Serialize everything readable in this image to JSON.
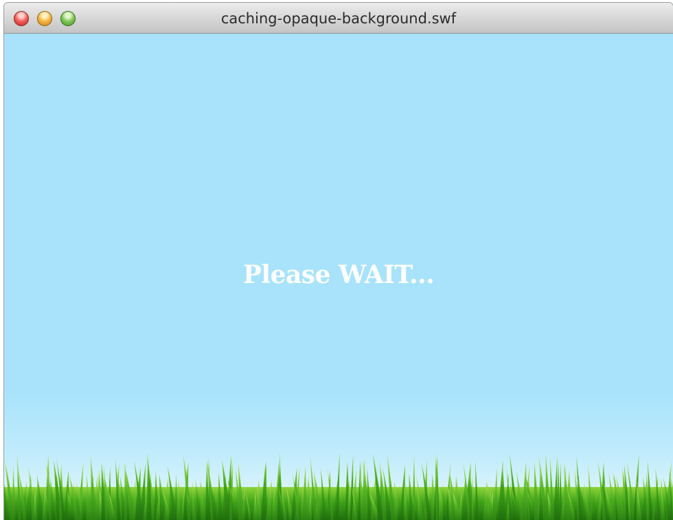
{
  "window": {
    "title": "caching-opaque-background.swf",
    "controls": {
      "close_color": "#f2605a",
      "minimize_color": "#f6b844",
      "maximize_color": "#84c85a"
    }
  },
  "stage": {
    "message": "Please WAIT...",
    "sky_color": "#a8e3fb",
    "grass_color": "#3fa319"
  }
}
